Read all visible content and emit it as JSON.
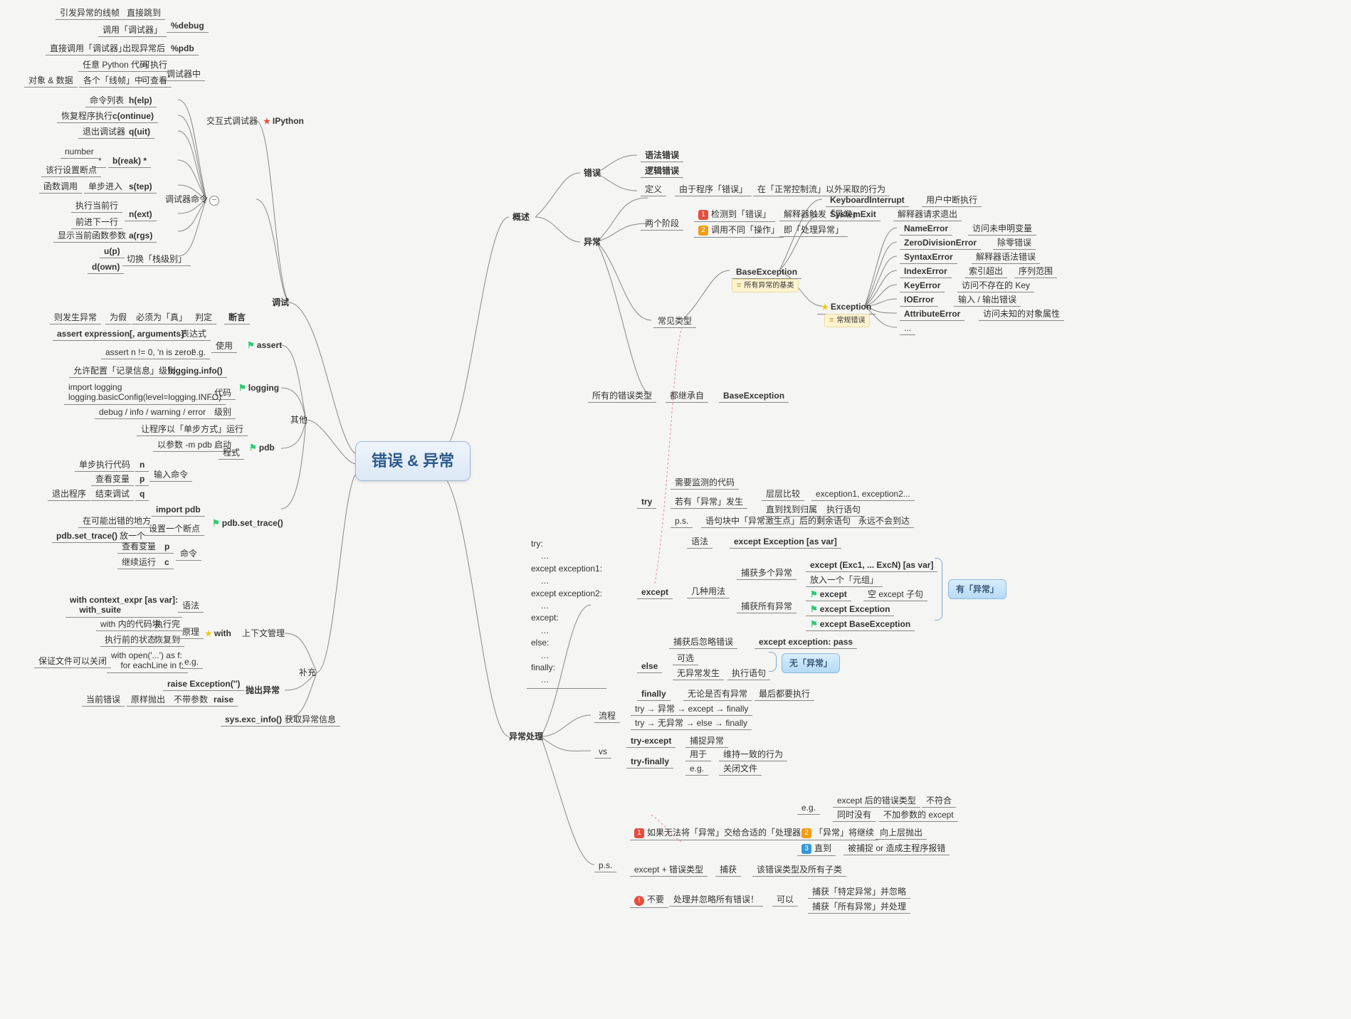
{
  "root": "错误 & 异常",
  "l1": {
    "debug": "调试",
    "other": "其他",
    "suppl": "补充",
    "interactive": "交互式调试器",
    "dbgcmd": "调试器命令",
    "ipython": "IPython",
    "ctxmgr": "上下文管理"
  },
  "debugger": {
    "pdebug": "%debug",
    "ppdb": "%pdb",
    "inDbg": "调试器中",
    "d1a": "引发异常的线帧",
    "d1b": "直接跳到",
    "d2": "调用「调试器」",
    "d3a": "直接调用「调试器」",
    "d3b": "出现异常后",
    "d4a": "任意 Python 代码",
    "d4b": "可执行",
    "d5a": "对象 & 数据",
    "d5b": "各个「线帧」中",
    "d5c": "可查看"
  },
  "cmds": {
    "help": "h(elp)",
    "helpd": "命令列表",
    "cont": "c(ontinue)",
    "contd": "恢复程序执行",
    "quit": "q(uit)",
    "quitd": "退出调试器",
    "break": "b(reak) *",
    "breakA": "number",
    "breakB": "*",
    "breakC": "该行设置断点",
    "step": "s(tep)",
    "stepA": "函数调用",
    "stepB": "单步进入",
    "next": "n(ext)",
    "nextA": "执行当前行",
    "nextB": "前进下一行",
    "args": "a(rgs)",
    "argsd": "显示当前函数参数",
    "up": "u(p)",
    "down": "d(own)",
    "udd": "切换「栈级别」"
  },
  "ass": {
    "t": "assert",
    "t2": "断言",
    "j": "判定",
    "j1": "必须为「真」",
    "j2": "为假",
    "j3": "则发生异常",
    "use": "使用",
    "expr": "表达式",
    "exprv": "assert expression[, arguments]",
    "eg": "e.g.",
    "egv": "assert n != 0, 'n is zero!'"
  },
  "log": {
    "t": "logging",
    "info": "logging.info()",
    "infod": "允许配置「记录信息」级别",
    "code": "代码",
    "codev": "import logging\nlogging.basicConfig(level=logging.INFO)",
    "lvl": "级别",
    "lvlv": "debug / info / warning / error"
  },
  "pdb": {
    "t": "pdb",
    "r1": "让程序以「单步方式」运行",
    "r2": "以参数 -m pdb 启动",
    "mode": "程式",
    "in": "输入命令",
    "n": "n",
    "nd": "单步执行代码",
    "p": "p",
    "pd": "查看变量",
    "q": "q",
    "qd": "退出程序",
    "qd2": "结束调试"
  },
  "trace": {
    "t": "pdb.set_trace()",
    "imp": "import pdb",
    "br": "设置一个断点",
    "br1": "在可能出错的地方",
    "br2": "放一个",
    "brv": "pdb.set_trace()",
    "cmd": "命令",
    "p": "p",
    "pd": "查看变量",
    "c": "c",
    "cd": "继续运行"
  },
  "with": {
    "t": "with",
    "syn": "语法",
    "synv": "with context_expr [as var]:\n    with_suite",
    "pr": "原理",
    "pr1": "with 内的代码块",
    "pr1b": "执行完",
    "pr2": "执行前的状态",
    "pr2b": "恢复到",
    "eg": "e.g.",
    "egv": "with open('...') as f:\n    for eachLine in f:",
    "egd": "保证文件可以关闭"
  },
  "raise": {
    "t": "抛出异常",
    "r1": "raise Exception('')",
    "r1d": "原样抛出",
    "r2": "raise",
    "r2a": "当前错误",
    "r2b": "原样抛出",
    "r2c": "不带参数",
    "sei": "sys.exc_info()",
    "seid": "获取异常信息"
  },
  "ov": {
    "t": "概述",
    "err": "错误",
    "syn": "语法错误",
    "logic": "逻辑错误",
    "def": "定义",
    "def1": "由于程序「错误」",
    "def2": "在「正常控制流」以外采取的行为",
    "phase": "两个阶段",
    "p1a": "检测到「错误」",
    "p1b": "解释器触发「异常」",
    "p2a": "调用不同「操作」",
    "p2b": "即「处理异常」",
    "exc": "异常",
    "common": "常见类型",
    "base": "BaseException",
    "baseN": "所有异常的基类",
    "ebase": "Exception",
    "ebaseN": "常规错误",
    "ki": "KeyboardInterrupt",
    "kid": "用户中断执行",
    "se": "SystemExit",
    "sed": "解释器请求退出",
    "ne": "NameError",
    "ned": "访问未申明变量",
    "zde": "ZeroDivisionError",
    "zded": "除零错误",
    "sye": "SyntaxError",
    "syed": "解释器语法错误",
    "ie": "IndexError",
    "ied": "索引超出",
    "ied2": "序列范围",
    "ke": "KeyError",
    "ked": "访问不存在的 Key",
    "ioe": "IOError",
    "ioed": "输入 / 输出错误",
    "ae": "AttributeError",
    "aed": "访问未知的对象属性",
    "dots": "...",
    "all": "所有的错误类型",
    "all2": "都继承自",
    "all3": "BaseException"
  },
  "eh": {
    "t": "异常处理",
    "codeLabel": "try:\n    …\nexcept exception1:\n    …\nexcept exception2:\n    …\nexcept:\n    …\nelse:\n    …\nfinally:\n    …",
    "try": "try",
    "tryd": "需要监测的代码",
    "tryc": "若有「异常」发生",
    "tc1": "层层比较",
    "tc1b": "exception1, exception2...",
    "tc2": "直到找到归属",
    "tc2b": "执行语句",
    "ps": "p.s.",
    "psd": "语句块中「异常激生点」后的剩余语句",
    "psd2": "永远不会到达",
    "except": "except",
    "esyn": "语法",
    "esynv": "except Exception [as var]",
    "emul": "几种用法",
    "emul1": "捕获多个异常",
    "emul1a": "except (Exc1, ... ExcN) [as var]",
    "emul1b": "放入一个「元组」",
    "emul2": "捕获所有异常",
    "emul2a": "except",
    "emul2ad": "空 except 子句",
    "emul2b": "except Exception",
    "emul2c": "except BaseException",
    "ign": "捕获后忽略错误",
    "ignv": "except exception: pass",
    "else": "else",
    "elsed": "可选",
    "elsed2": "无异常发生",
    "elsed3": "执行语句",
    "fin": "finally",
    "find": "无论是否有异常",
    "find2": "最后都要执行",
    "flow": "流程",
    "flow1": "try → 异常 → except → finally",
    "flow2": "try → 无异常 → else → finally",
    "vs": "vs",
    "vs1": "try-except",
    "vs1d": "捕捉异常",
    "vs2": "try-finally",
    "vs2a": "用于",
    "vs2b": "维持一致的行为",
    "vs2c": "e.g.",
    "vs2d": "关闭文件",
    "psT": "p.s.",
    "ps1": "如果无法将「异常」交给合适的「处理器」",
    "ps1eg": "e.g.",
    "ps1a": "except 后的错误类型",
    "ps1ad": "不符合",
    "ps1b": "同时没有",
    "ps1bd": "不加参数的 except",
    "ps2": "「异常」将继续",
    "ps2d": "向上层抛出",
    "ps3": "直到",
    "ps3d": "被捕捉 or 造成主程序报错",
    "pse": "except + 错误类型",
    "psed": "捕获",
    "psed2": "该错误类型及所有子类",
    "psw": "不要",
    "pswd": "处理并忽略所有错误！",
    "pswi": "可以",
    "pswa": "捕获「特定异常」并忽略",
    "pswb": "捕获「所有异常」并处理",
    "hx1": "有「异常」",
    "hx2": "无「异常」"
  }
}
